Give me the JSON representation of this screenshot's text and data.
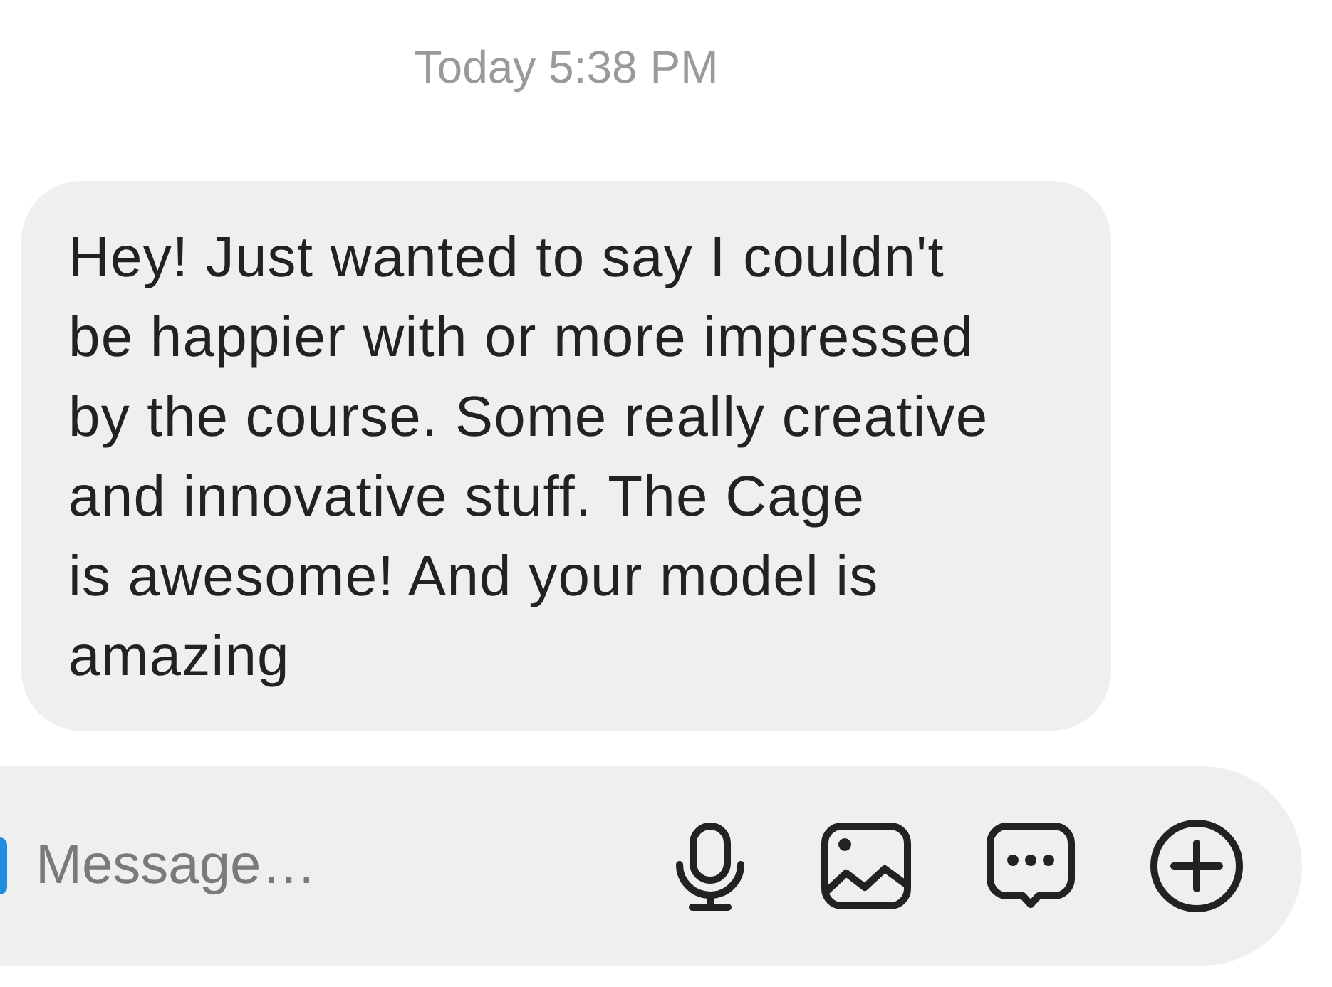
{
  "timestamp": "Today 5:38 PM",
  "messages": [
    {
      "text": "Hey! Just wanted to say I couldn't\nbe happier with or more impressed\nby the course. Some really creative\nand innovative stuff. The Cage\nis awesome! And your model is\namazing"
    }
  ],
  "composer": {
    "placeholder": "Message…",
    "actions": [
      {
        "kind": "microphone"
      },
      {
        "kind": "image"
      },
      {
        "kind": "chat"
      },
      {
        "kind": "add"
      }
    ]
  }
}
